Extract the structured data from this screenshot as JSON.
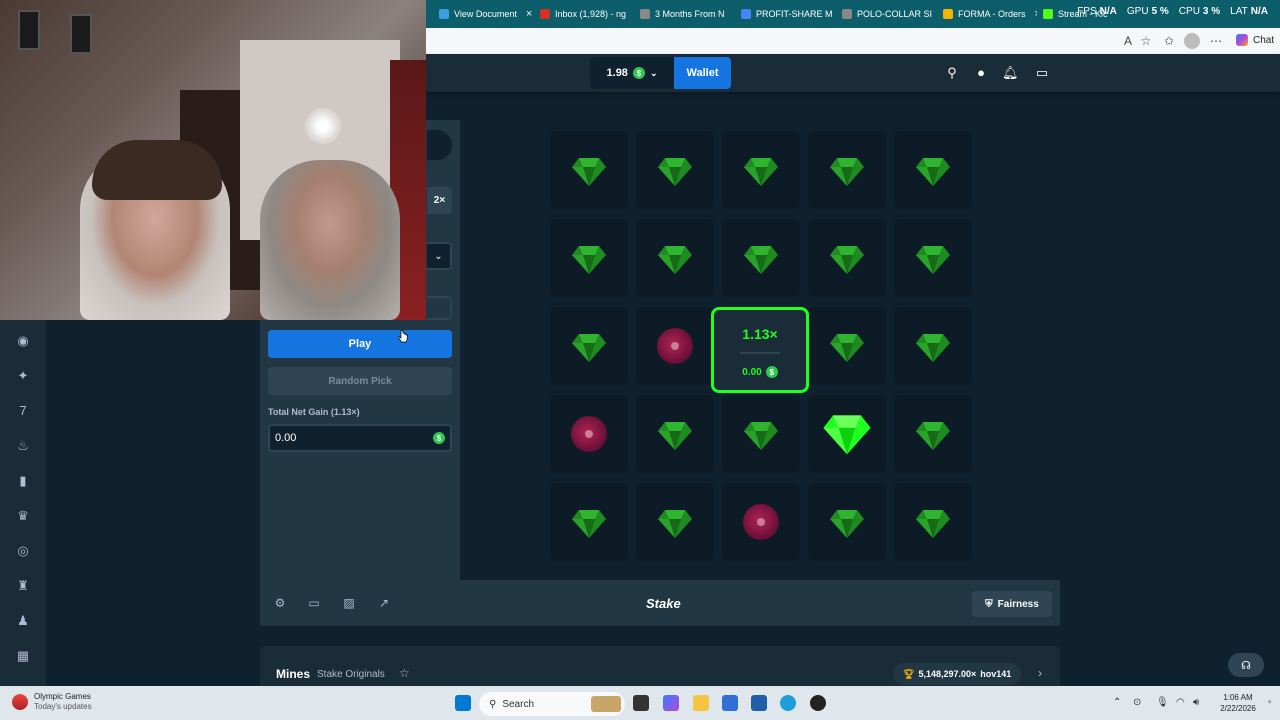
{
  "browser": {
    "tabs": [
      {
        "title": "View Document",
        "color": "#3aa0e0"
      },
      {
        "title": "Inbox (1,928) - ng",
        "color": "#d93025"
      },
      {
        "title": "3 Months From N",
        "color": "#888888"
      },
      {
        "title": "PROFIT-SHARE M",
        "color": "#4285f4"
      },
      {
        "title": "POLO-COLLAR SI",
        "color": "#888888"
      },
      {
        "title": "FORMA - Orders",
        "color": "#f4b400"
      },
      {
        "title": "Stream - Kick Da",
        "color": "#53fc18"
      }
    ],
    "stats": [
      {
        "label": "FPS",
        "value": "N/A"
      },
      {
        "label": "GPU",
        "value": "5 %"
      },
      {
        "label": "CPU",
        "value": "3 %"
      },
      {
        "label": "LAT",
        "value": "N/A"
      }
    ],
    "chat_label": "Chat"
  },
  "header": {
    "balance": "1.98",
    "currency_symbol": "$",
    "wallet_label": "Wallet"
  },
  "controls": {
    "multiplier_button": "2×",
    "play_label": "Play",
    "random_pick_label": "Random Pick",
    "net_gain_label": "Total Net Gain (1.13×)",
    "net_gain_value": "0.00"
  },
  "grid": {
    "rows": [
      [
        "gem-dim",
        "gem-dim",
        "gem-dim",
        "gem-dim",
        "gem-dim"
      ],
      [
        "gem-dim",
        "gem-dim",
        "gem-dim",
        "gem-dim",
        "gem-dim"
      ],
      [
        "gem-dim",
        "mine",
        "cashout",
        "gem-dim",
        "gem-dim"
      ],
      [
        "mine",
        "gem-dim",
        "gem-dim",
        "gem-bright",
        "gem-dim"
      ],
      [
        "gem-dim",
        "gem-dim",
        "mine",
        "gem-dim",
        "gem-dim"
      ]
    ],
    "cashout_multiplier": "1.13×",
    "cashout_amount": "0.00"
  },
  "footer": {
    "logo": "Stake",
    "fairness_label": "Fairness"
  },
  "info": {
    "title": "Mines",
    "subtitle": "Stake Originals",
    "winner_amount": "5,148,297.00×",
    "winner_user": "hov141"
  },
  "taskbar": {
    "news_title": "Olympic Games",
    "news_sub": "Today's updates",
    "search_placeholder": "Search",
    "time": "1:06 AM",
    "date": "2/22/2026"
  },
  "colors": {
    "accent_blue": "#1475e1",
    "gem_green": "#1fff20",
    "bg": "#0f212e"
  }
}
